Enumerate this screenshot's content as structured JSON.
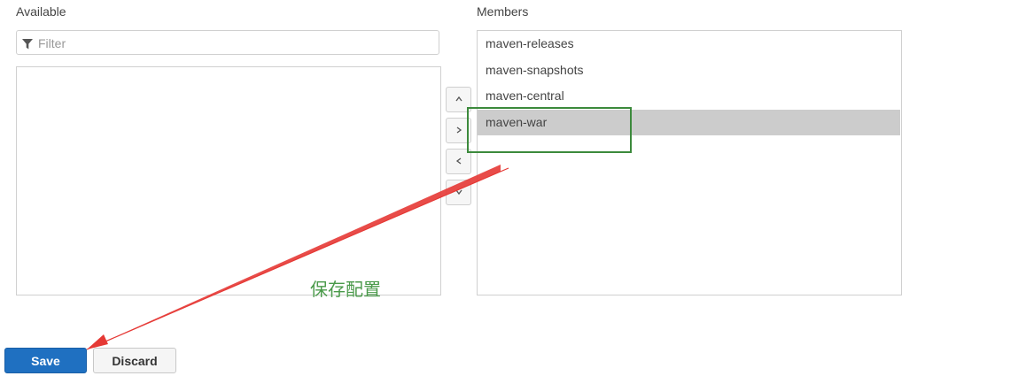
{
  "available": {
    "title": "Available",
    "filter_placeholder": "Filter",
    "items": []
  },
  "members": {
    "title": "Members",
    "items": [
      {
        "label": "maven-releases",
        "selected": false
      },
      {
        "label": "maven-snapshots",
        "selected": false
      },
      {
        "label": "maven-central",
        "selected": false
      },
      {
        "label": "maven-war",
        "selected": true
      }
    ]
  },
  "move_controls": [
    {
      "name": "move-up-button",
      "icon": "chevron-up-icon"
    },
    {
      "name": "add-member-button",
      "icon": "chevron-right-icon"
    },
    {
      "name": "remove-member-button",
      "icon": "chevron-left-icon"
    },
    {
      "name": "move-down-button",
      "icon": "chevron-down-icon"
    }
  ],
  "actions": {
    "save_label": "Save",
    "discard_label": "Discard"
  },
  "annotation": {
    "note": "保存配置",
    "highlight_color": "#3c8a3c",
    "arrow_color": "#e53935"
  },
  "colors": {
    "primary": "#1f70c1",
    "selected_row": "#cccccc",
    "border": "#d0d0d0"
  }
}
